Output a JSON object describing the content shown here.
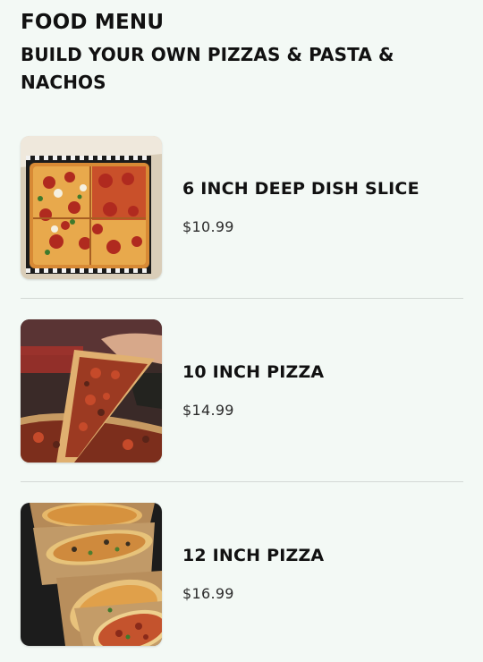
{
  "header": {
    "title": "FOOD MENU",
    "subtitle": "BUILD YOUR OWN PIZZAS & PASTA & NACHOS"
  },
  "items": [
    {
      "name": "6 INCH DEEP DISH SLICE",
      "price": "$10.99",
      "image_icon": "deep-dish-slice-photo"
    },
    {
      "name": "10 INCH PIZZA",
      "price": "$14.99",
      "image_icon": "pizza-slice-pull-photo"
    },
    {
      "name": "12 INCH PIZZA",
      "price": "$16.99",
      "image_icon": "pizzas-in-boxes-photo"
    }
  ],
  "colors": {
    "background": "#f3f9f5",
    "text": "#111111",
    "divider": "#d3d8d5"
  }
}
